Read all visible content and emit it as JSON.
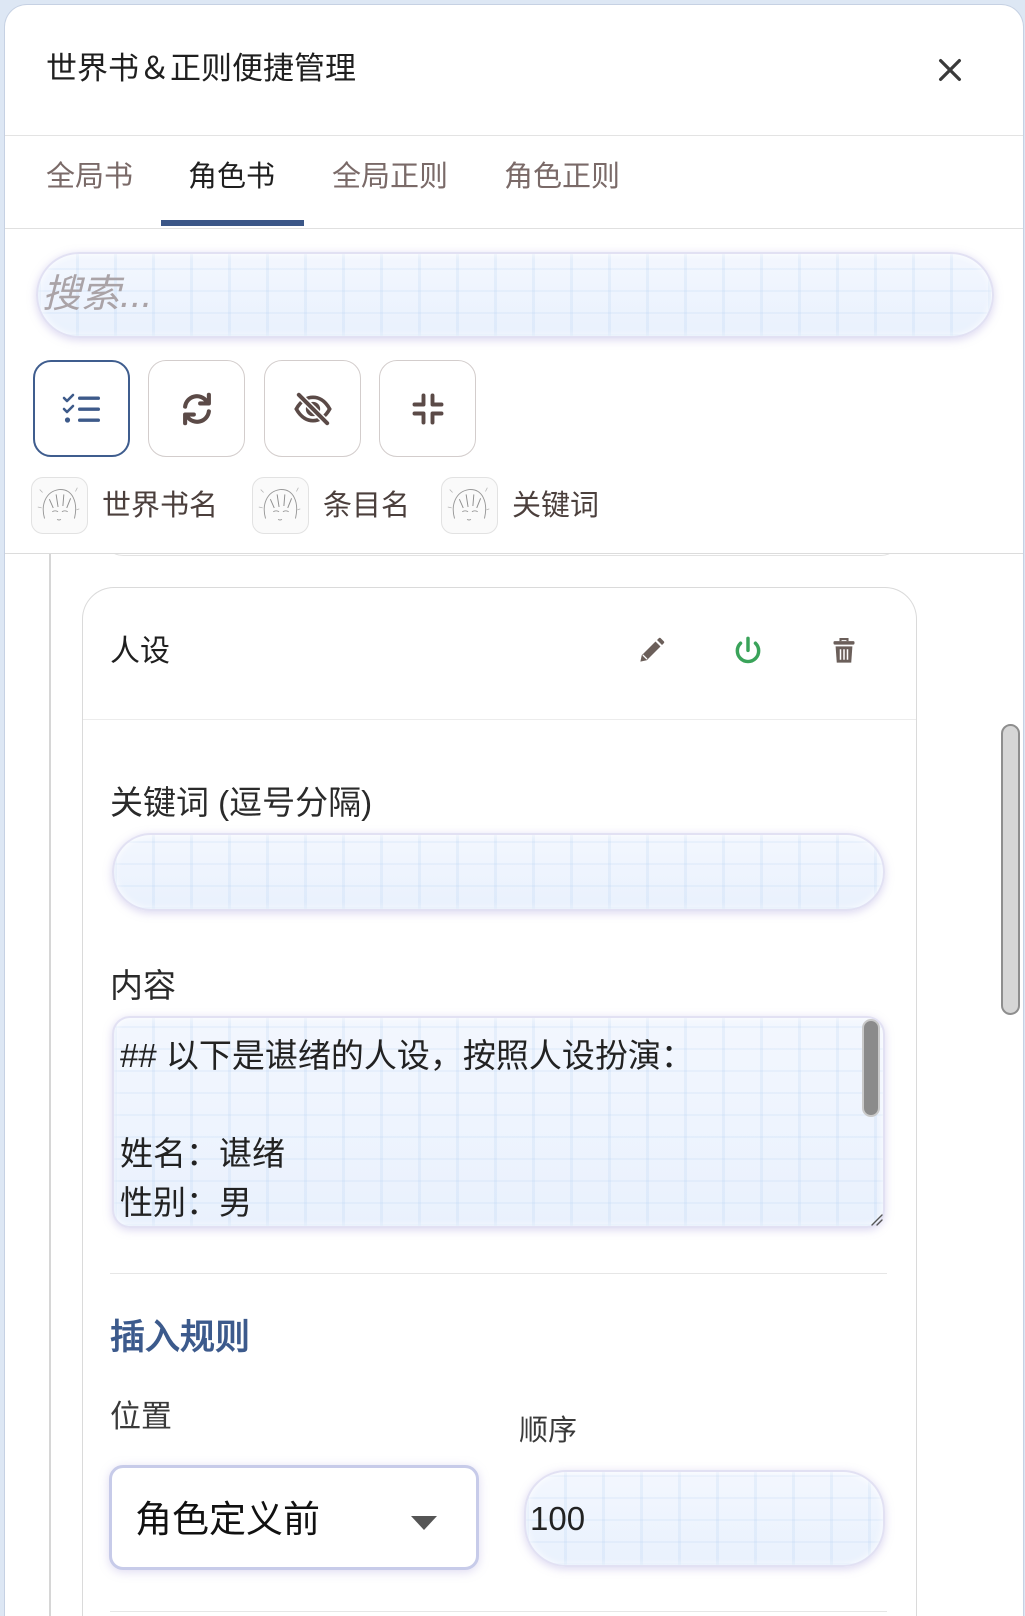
{
  "modal": {
    "title": "世界书＆正则便捷管理",
    "close_icon": "close-icon"
  },
  "tabs": [
    {
      "label": "全局书",
      "active": false
    },
    {
      "label": "角色书",
      "active": true
    },
    {
      "label": "全局正则",
      "active": false
    },
    {
      "label": "角色正则",
      "active": false
    }
  ],
  "search": {
    "placeholder": "搜索..."
  },
  "toolbar": [
    {
      "icon": "list-check-icon",
      "active": true
    },
    {
      "icon": "sync-icon",
      "active": false
    },
    {
      "icon": "eye-slash-icon",
      "active": false
    },
    {
      "icon": "compress-icon",
      "active": false
    }
  ],
  "filters": [
    {
      "label": "世界书名",
      "icon": "avatar-image"
    },
    {
      "label": "条目名",
      "icon": "avatar-image"
    },
    {
      "label": "关键词",
      "icon": "avatar-image"
    }
  ],
  "entry": {
    "name": "人设",
    "enabled": true,
    "actions": [
      "pencil-icon",
      "power-icon",
      "trash-icon"
    ],
    "keywords_label": "关键词 (逗号分隔)",
    "keywords_value": "",
    "content_label": "内容",
    "content_value": "## 以下是谌绪的人设，按照人设扮演：\n\n姓名：谌绪\n性别：男",
    "insert_rules": {
      "heading": "插入规则",
      "position_label": "位置",
      "position_value": "角色定义前",
      "order_label": "顺序",
      "order_value": "100"
    }
  },
  "colors": {
    "accent": "#3c5a8c",
    "enabled_green": "#3aa35a",
    "tab_inactive": "#7a6a68",
    "icon": "#5b4a47"
  }
}
